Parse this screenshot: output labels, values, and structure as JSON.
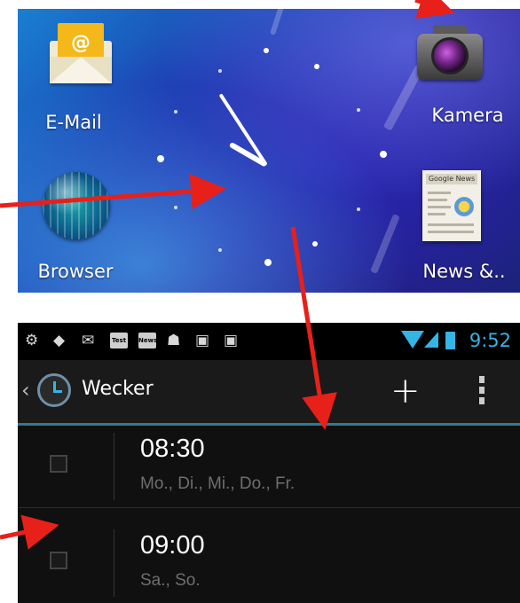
{
  "home_screen": {
    "apps": [
      {
        "label": "E-Mail",
        "icon": "email-envelope-icon",
        "badge": "@"
      },
      {
        "label": "Kamera",
        "icon": "camera-icon"
      },
      {
        "label": "Browser",
        "icon": "globe-icon"
      },
      {
        "label": "News &..",
        "icon": "newspaper-icon",
        "masthead": "Google News"
      }
    ],
    "widget": "analog-clock"
  },
  "status_bar": {
    "notification_icons": [
      "settings-icon",
      "sync-icon",
      "mail-icon",
      "test-app-icon",
      "news-app-icon",
      "android-icon",
      "store-bag-icon",
      "store-bag-icon"
    ],
    "test_label": "Test",
    "news_label": "News",
    "time": "9:52",
    "accent_color": "#33b5e5"
  },
  "action_bar": {
    "title": "Wecker",
    "add_label": "+"
  },
  "alarms": [
    {
      "time": "08:30",
      "days": "Mo., Di., Mi., Do., Fr.",
      "enabled": false
    },
    {
      "time": "09:00",
      "days": "Sa., So.",
      "enabled": false
    }
  ],
  "annotation_color": "#e8201a"
}
